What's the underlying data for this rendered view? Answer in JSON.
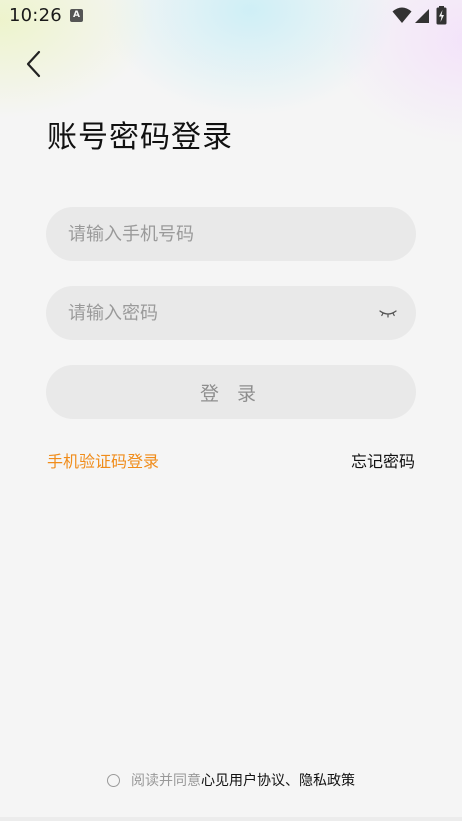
{
  "status_bar": {
    "time": "10:26",
    "notification_letter": "A",
    "icons": [
      "wifi-icon",
      "signal-icon",
      "battery-charging-icon"
    ]
  },
  "header": {
    "back_icon": "chevron-left-icon",
    "title": "账号密码登录"
  },
  "form": {
    "phone_placeholder": "请输入手机号码",
    "phone_value": "",
    "password_placeholder": "请输入密码",
    "password_value": "",
    "password_toggle_icon": "eye-closed-icon",
    "login_label": "登 录"
  },
  "links": {
    "sms_login": "手机验证码登录",
    "forgot_password": "忘记密码"
  },
  "agreement": {
    "prefix": "阅读并同意",
    "user_agreement": "心见用户协议",
    "separator": "、",
    "privacy_policy": "隐私政策",
    "checked": false
  },
  "colors": {
    "accent": "#f08c1a",
    "field_bg": "#e9e9e9",
    "page_bg": "#f5f5f5"
  }
}
